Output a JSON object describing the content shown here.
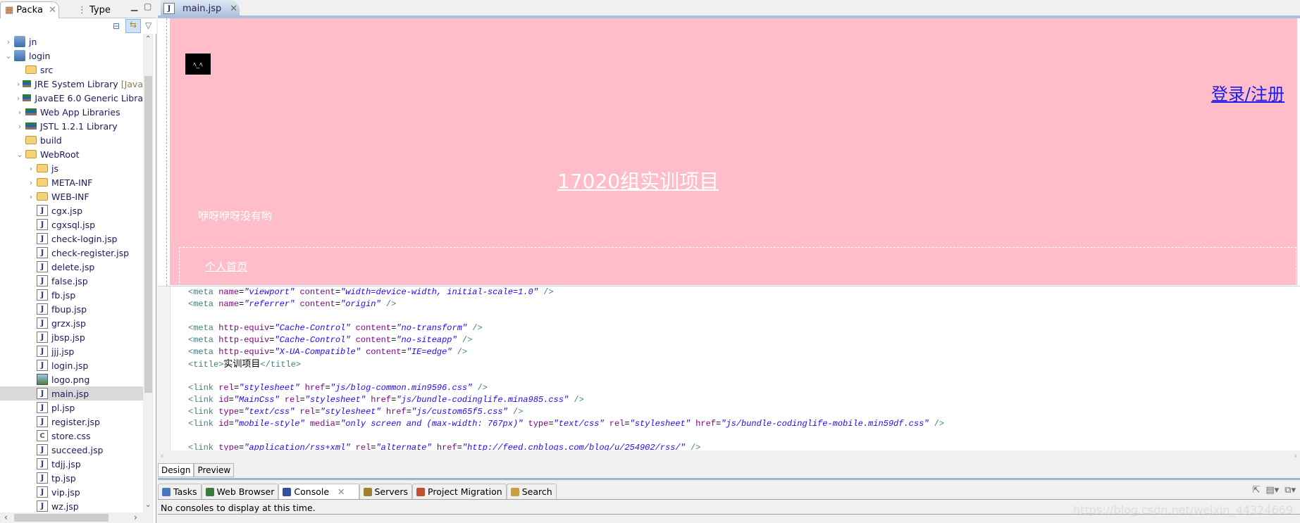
{
  "explorer": {
    "tabs": [
      {
        "label": "Packa",
        "icon": "package-explorer-icon"
      },
      {
        "label": "Type",
        "icon": "type-hierarchy-icon"
      }
    ],
    "items": [
      {
        "label": "jn",
        "depth": 0,
        "chevron": "›",
        "icon": "proj"
      },
      {
        "label": "login",
        "depth": 0,
        "chevron": "⌄",
        "icon": "proj"
      },
      {
        "label": "src",
        "depth": 1,
        "chevron": "",
        "icon": "folder"
      },
      {
        "label": "JRE System Library",
        "suffix": "[Java",
        "depth": 1,
        "chevron": "›",
        "icon": "lib"
      },
      {
        "label": "JavaEE 6.0 Generic Libra",
        "depth": 1,
        "chevron": "›",
        "icon": "lib"
      },
      {
        "label": "Web App Libraries",
        "depth": 1,
        "chevron": "›",
        "icon": "lib"
      },
      {
        "label": "JSTL 1.2.1 Library",
        "depth": 1,
        "chevron": "›",
        "icon": "lib"
      },
      {
        "label": "build",
        "depth": 1,
        "chevron": "",
        "icon": "folder"
      },
      {
        "label": "WebRoot",
        "depth": 1,
        "chevron": "⌄",
        "icon": "folder"
      },
      {
        "label": "js",
        "depth": 2,
        "chevron": "›",
        "icon": "folder"
      },
      {
        "label": "META-INF",
        "depth": 2,
        "chevron": "›",
        "icon": "folder"
      },
      {
        "label": "WEB-INF",
        "depth": 2,
        "chevron": "›",
        "icon": "folder"
      },
      {
        "label": "cgx.jsp",
        "depth": 2,
        "icon": "jsp"
      },
      {
        "label": "cgxsql.jsp",
        "depth": 2,
        "icon": "jsp"
      },
      {
        "label": "check-login.jsp",
        "depth": 2,
        "icon": "jsp"
      },
      {
        "label": "check-register.jsp",
        "depth": 2,
        "icon": "jsp"
      },
      {
        "label": "delete.jsp",
        "depth": 2,
        "icon": "jsp"
      },
      {
        "label": "false.jsp",
        "depth": 2,
        "icon": "jsp"
      },
      {
        "label": "fb.jsp",
        "depth": 2,
        "icon": "jsp"
      },
      {
        "label": "fbup.jsp",
        "depth": 2,
        "icon": "jsp"
      },
      {
        "label": "grzx.jsp",
        "depth": 2,
        "icon": "jsp"
      },
      {
        "label": "jbsp.jsp",
        "depth": 2,
        "icon": "jsp"
      },
      {
        "label": "jjj.jsp",
        "depth": 2,
        "icon": "jsp"
      },
      {
        "label": "login.jsp",
        "depth": 2,
        "icon": "jsp"
      },
      {
        "label": "logo.png",
        "depth": 2,
        "icon": "img"
      },
      {
        "label": "main.jsp",
        "depth": 2,
        "icon": "jsp",
        "selected": true
      },
      {
        "label": "pl.jsp",
        "depth": 2,
        "icon": "jsp"
      },
      {
        "label": "register.jsp",
        "depth": 2,
        "icon": "jsp"
      },
      {
        "label": "store.css",
        "depth": 2,
        "icon": "css"
      },
      {
        "label": "succeed.jsp",
        "depth": 2,
        "icon": "jsp"
      },
      {
        "label": "tdjj.jsp",
        "depth": 2,
        "icon": "jsp"
      },
      {
        "label": "tp.jsp",
        "depth": 2,
        "icon": "jsp"
      },
      {
        "label": "vip.jsp",
        "depth": 2,
        "icon": "jsp"
      },
      {
        "label": "wz.jsp",
        "depth": 2,
        "icon": "jsp"
      }
    ]
  },
  "editor": {
    "tab_label": "main.jsp",
    "preview": {
      "bg_color": "#ffbdca",
      "login_link": "登录/注册",
      "title": "17020组实训项目",
      "subtitle": "咿呀咿呀没有哟",
      "home_link": "个人首页"
    },
    "code_lines": [
      [
        [
          "t",
          "<meta "
        ],
        [
          "a",
          "name"
        ],
        [
          "x0",
          "="
        ],
        [
          "v",
          "\"viewport\""
        ],
        [
          "x0",
          " "
        ],
        [
          "a",
          "content"
        ],
        [
          "x0",
          "="
        ],
        [
          "v",
          "\"width=device-width, initial-scale=1.0\""
        ],
        [
          "t",
          " />"
        ]
      ],
      [
        [
          "t",
          "<meta "
        ],
        [
          "a",
          "name"
        ],
        [
          "x0",
          "="
        ],
        [
          "v",
          "\"referrer\""
        ],
        [
          "x0",
          " "
        ],
        [
          "a",
          "content"
        ],
        [
          "x0",
          "="
        ],
        [
          "v",
          "\"origin\""
        ],
        [
          "t",
          " />"
        ]
      ],
      [],
      [
        [
          "t",
          "<meta "
        ],
        [
          "a",
          "http-equiv"
        ],
        [
          "x0",
          "="
        ],
        [
          "v",
          "\"Cache-Control\""
        ],
        [
          "x0",
          " "
        ],
        [
          "a",
          "content"
        ],
        [
          "x0",
          "="
        ],
        [
          "v",
          "\"no-transform\""
        ],
        [
          "t",
          " />"
        ]
      ],
      [
        [
          "t",
          "<meta "
        ],
        [
          "a",
          "http-equiv"
        ],
        [
          "x0",
          "="
        ],
        [
          "v",
          "\"Cache-Control\""
        ],
        [
          "x0",
          " "
        ],
        [
          "a",
          "content"
        ],
        [
          "x0",
          "="
        ],
        [
          "v",
          "\"no-siteapp\""
        ],
        [
          "t",
          " />"
        ]
      ],
      [
        [
          "t",
          "<meta "
        ],
        [
          "a",
          "http-equiv"
        ],
        [
          "x0",
          "="
        ],
        [
          "v",
          "\"X-UA-Compatible\""
        ],
        [
          "x0",
          " "
        ],
        [
          "a",
          "content"
        ],
        [
          "x0",
          "="
        ],
        [
          "v",
          "\"IE=edge\""
        ],
        [
          "t",
          " />"
        ]
      ],
      [
        [
          "t",
          "<title>"
        ],
        [
          "x",
          "实训项目"
        ],
        [
          "t",
          "</title>"
        ]
      ],
      [],
      [
        [
          "t",
          "<link "
        ],
        [
          "a",
          "rel"
        ],
        [
          "x0",
          "="
        ],
        [
          "v",
          "\"stylesheet\""
        ],
        [
          "x0",
          " "
        ],
        [
          "a",
          "href"
        ],
        [
          "x0",
          "="
        ],
        [
          "v",
          "\"js/blog-common.min9596.css\""
        ],
        [
          "t",
          " />"
        ]
      ],
      [
        [
          "t",
          "<link "
        ],
        [
          "a",
          "id"
        ],
        [
          "x0",
          "="
        ],
        [
          "v",
          "\"MainCss\""
        ],
        [
          "x0",
          " "
        ],
        [
          "a",
          "rel"
        ],
        [
          "x0",
          "="
        ],
        [
          "v",
          "\"stylesheet\""
        ],
        [
          "x0",
          " "
        ],
        [
          "a",
          "href"
        ],
        [
          "x0",
          "="
        ],
        [
          "v",
          "\"js/bundle-codinglife.mina985.css\""
        ],
        [
          "t",
          " />"
        ]
      ],
      [
        [
          "t",
          "<link "
        ],
        [
          "a",
          "type"
        ],
        [
          "x0",
          "="
        ],
        [
          "v",
          "\"text/css\""
        ],
        [
          "x0",
          " "
        ],
        [
          "a",
          "rel"
        ],
        [
          "x0",
          "="
        ],
        [
          "v",
          "\"stylesheet\""
        ],
        [
          "x0",
          " "
        ],
        [
          "a",
          "href"
        ],
        [
          "x0",
          "="
        ],
        [
          "v",
          "\"js/custom65f5.css\""
        ],
        [
          "t",
          " />"
        ]
      ],
      [
        [
          "t",
          "<link "
        ],
        [
          "a",
          "id"
        ],
        [
          "x0",
          "="
        ],
        [
          "v",
          "\"mobile-style\""
        ],
        [
          "x0",
          " "
        ],
        [
          "a",
          "media"
        ],
        [
          "x0",
          "="
        ],
        [
          "v",
          "\"only screen and (max-width: 767px)\""
        ],
        [
          "x0",
          " "
        ],
        [
          "a",
          "type"
        ],
        [
          "x0",
          "="
        ],
        [
          "v",
          "\"text/css\""
        ],
        [
          "x0",
          " "
        ],
        [
          "a",
          "rel"
        ],
        [
          "x0",
          "="
        ],
        [
          "v",
          "\"stylesheet\""
        ],
        [
          "x0",
          " "
        ],
        [
          "a",
          "href"
        ],
        [
          "x0",
          "="
        ],
        [
          "v",
          "\"js/bundle-codinglife-mobile.min59df.css\""
        ],
        [
          "t",
          " />"
        ]
      ],
      [],
      [
        [
          "t",
          "<link "
        ],
        [
          "a",
          "type"
        ],
        [
          "x0",
          "="
        ],
        [
          "v",
          "\"application/rss+xml\""
        ],
        [
          "x0",
          " "
        ],
        [
          "a",
          "rel"
        ],
        [
          "x0",
          "="
        ],
        [
          "v",
          "\"alternate\""
        ],
        [
          "x0",
          " "
        ],
        [
          "a",
          "href"
        ],
        [
          "x0",
          "="
        ],
        [
          "v",
          "\"http://feed.cnblogs.com/blog/u/254902/rss/\""
        ],
        [
          "t",
          " />"
        ]
      ]
    ],
    "view_tabs": [
      "Design",
      "Preview"
    ]
  },
  "bottom": {
    "tabs": [
      {
        "label": "Tasks",
        "color": "#4a78c0"
      },
      {
        "label": "Web Browser",
        "color": "#3a7a3a"
      },
      {
        "label": "Console",
        "color": "#3050a0",
        "active": true
      },
      {
        "label": "Servers",
        "color": "#a08030"
      },
      {
        "label": "Project Migration",
        "color": "#c05030"
      },
      {
        "label": "Search",
        "color": "#c8a040"
      }
    ],
    "console_text": "No consoles to display at this time.",
    "watermark": "https://blog.csdn.net/weixin_44324669"
  }
}
